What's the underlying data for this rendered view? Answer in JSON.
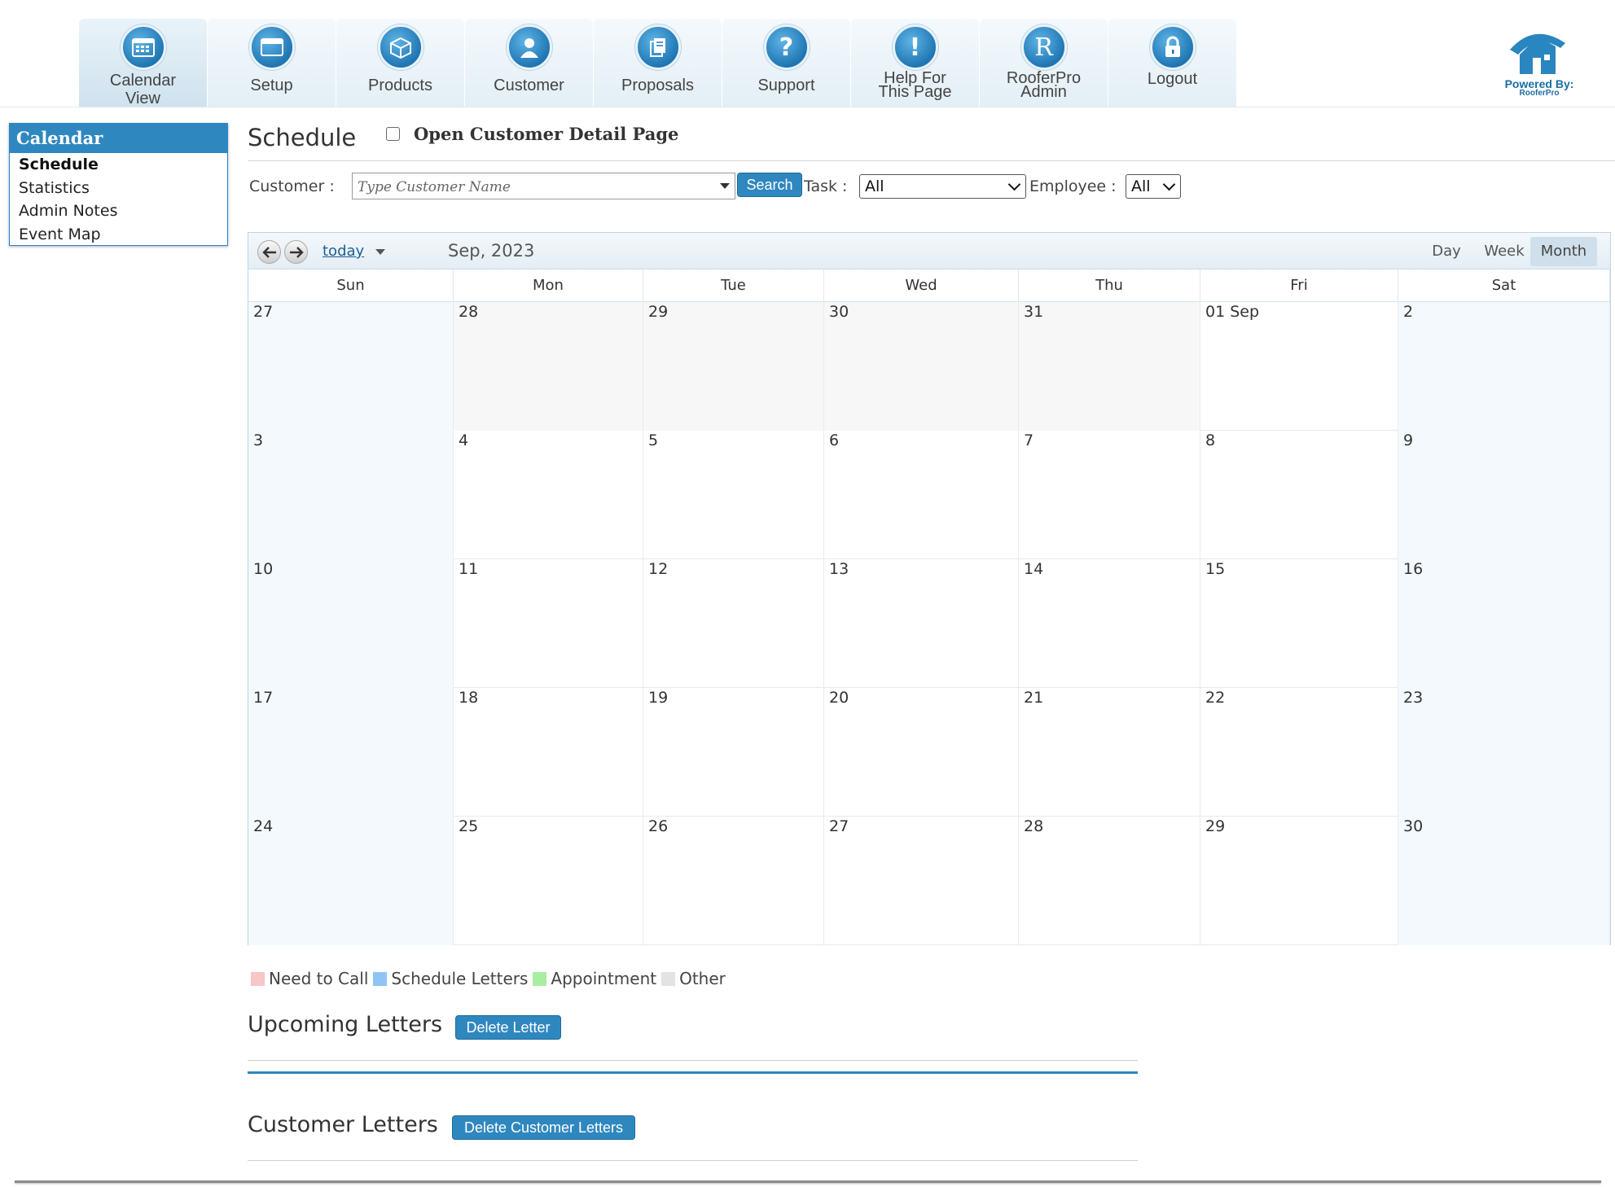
{
  "nav": {
    "tabs": [
      {
        "label_lines": [
          "Calendar",
          "View"
        ],
        "icon": "calendar-icon"
      },
      {
        "label_lines": [
          "Setup"
        ],
        "icon": "window-icon"
      },
      {
        "label_lines": [
          "Products"
        ],
        "icon": "box-icon"
      },
      {
        "label_lines": [
          "Customer"
        ],
        "icon": "user-icon"
      },
      {
        "label_lines": [
          "Proposals"
        ],
        "icon": "documents-icon"
      },
      {
        "label_lines": [
          "Support"
        ],
        "icon": "question-icon"
      },
      {
        "label_lines": [
          "Help For",
          "This Page"
        ],
        "icon": "exclamation-icon"
      },
      {
        "label_lines": [
          "RooferPro",
          "Admin"
        ],
        "icon": "r-letter-icon"
      },
      {
        "label_lines": [
          "Logout"
        ],
        "icon": "lock-icon"
      }
    ],
    "logo": {
      "line1": "Powered By:",
      "line2": "RooferPro"
    }
  },
  "sidebar": {
    "title": "Calendar",
    "items": [
      "Schedule",
      "Statistics",
      "Admin Notes",
      "Event Map"
    ],
    "active": "Schedule"
  },
  "page": {
    "title": "Schedule",
    "open_detail_label": "Open Customer Detail Page",
    "open_detail_checked": false
  },
  "filters": {
    "customer_label": "Customer :",
    "customer_placeholder": "Type Customer Name",
    "search_label": "Search",
    "task_label": "Task :",
    "task_value": "All",
    "employee_label": "Employee :",
    "employee_value": "All"
  },
  "calendar": {
    "today_label": "today",
    "month_label": "Sep, 2023",
    "views": [
      "Day",
      "Week",
      "Month"
    ],
    "active_view": "Month",
    "dow": [
      "Sun",
      "Mon",
      "Tue",
      "Wed",
      "Thu",
      "Fri",
      "Sat"
    ],
    "weeks": [
      [
        {
          "n": "27",
          "o": true
        },
        {
          "n": "28",
          "o": true
        },
        {
          "n": "29",
          "o": true
        },
        {
          "n": "30",
          "o": true
        },
        {
          "n": "31",
          "o": true
        },
        {
          "n": "01 Sep",
          "o": false
        },
        {
          "n": "2",
          "o": false
        }
      ],
      [
        {
          "n": "3",
          "o": false
        },
        {
          "n": "4",
          "o": false
        },
        {
          "n": "5",
          "o": false
        },
        {
          "n": "6",
          "o": false
        },
        {
          "n": "7",
          "o": false
        },
        {
          "n": "8",
          "o": false
        },
        {
          "n": "9",
          "o": false
        }
      ],
      [
        {
          "n": "10",
          "o": false
        },
        {
          "n": "11",
          "o": false
        },
        {
          "n": "12",
          "o": false
        },
        {
          "n": "13",
          "o": false
        },
        {
          "n": "14",
          "o": false
        },
        {
          "n": "15",
          "o": false
        },
        {
          "n": "16",
          "o": false
        }
      ],
      [
        {
          "n": "17",
          "o": false
        },
        {
          "n": "18",
          "o": false
        },
        {
          "n": "19",
          "o": false
        },
        {
          "n": "20",
          "o": false
        },
        {
          "n": "21",
          "o": false
        },
        {
          "n": "22",
          "o": false
        },
        {
          "n": "23",
          "o": false
        }
      ],
      [
        {
          "n": "24",
          "o": false
        },
        {
          "n": "25",
          "o": false
        },
        {
          "n": "26",
          "o": false
        },
        {
          "n": "27",
          "o": false
        },
        {
          "n": "28",
          "o": false
        },
        {
          "n": "29",
          "o": false
        },
        {
          "n": "30",
          "o": false
        }
      ]
    ]
  },
  "legend": [
    {
      "label": "Need to Call",
      "color": "#f7c6c7"
    },
    {
      "label": "Schedule Letters",
      "color": "#8ec5f5"
    },
    {
      "label": "Appointment",
      "color": "#a8eea1"
    },
    {
      "label": "Other",
      "color": "#e3e3e3"
    }
  ],
  "upcoming": {
    "title": "Upcoming Letters",
    "button": "Delete Letter"
  },
  "customer_letters": {
    "title": "Customer Letters",
    "button": "Delete Customer Letters"
  }
}
